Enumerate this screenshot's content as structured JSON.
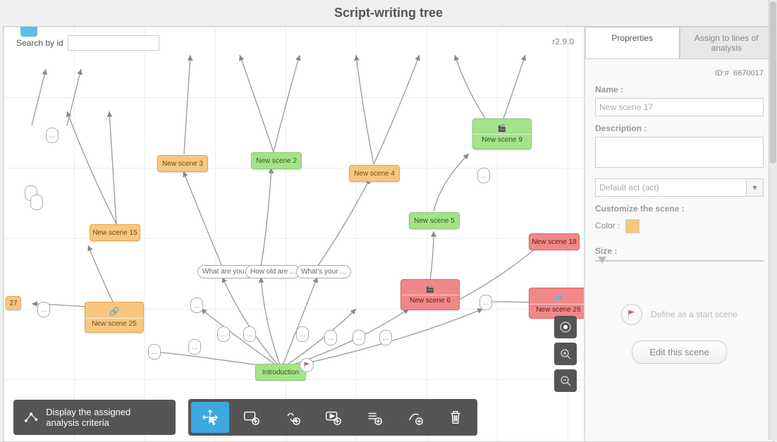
{
  "title": "Script-writing tree",
  "search_label": "Search by id",
  "version": "r2.9.0",
  "criteria_button": "Display the assigned analysis criteria",
  "nodes": {
    "intro": "Introduction",
    "n2": "New scene 2",
    "n3": "New scene 3",
    "n4": "New scene 4",
    "n5": "New scene 5",
    "n6": "New scene 6",
    "n9": "New scene 9",
    "n15": "New scene 15",
    "n18": "New scene 18",
    "n25": "New scene 25",
    "n26": "New scene 26",
    "n27": "27"
  },
  "speeches": {
    "s1": "What are you...",
    "s2": "How old are ...",
    "s3": "What's your ..."
  },
  "tabs": {
    "properties": "Proprerties",
    "assign": "Assign to lines of analysis"
  },
  "panel": {
    "id_label": "ID:#",
    "id_value": "6670017",
    "name_label": "Name :",
    "name_value": "New scene 17",
    "desc_label": "Description :",
    "act_value": "Default act (act)",
    "customize_label": "Customize the scene :",
    "color_label": "Color :",
    "size_label": "Size :",
    "define_start": "Define as a start scene",
    "edit": "Edit this scene"
  }
}
